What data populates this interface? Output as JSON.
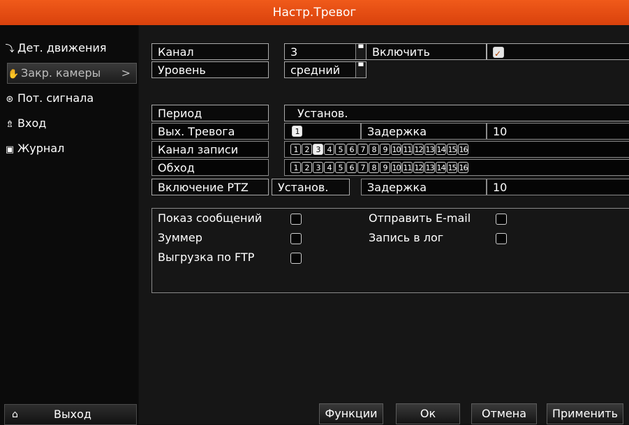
{
  "window": {
    "title": "Настр.Тревог"
  },
  "sidebar": {
    "items": [
      {
        "label": "Дет. движения",
        "icon": "motion-icon",
        "glyph": "⤵",
        "active": false
      },
      {
        "label": "Закр. камеры",
        "icon": "hand-icon",
        "glyph": "✋",
        "active": true,
        "chevron": ">"
      },
      {
        "label": "Пот. сигнала",
        "icon": "signal-icon",
        "glyph": "⊛",
        "active": false
      },
      {
        "label": "Вход",
        "icon": "input-icon",
        "glyph": "⇯",
        "active": false
      },
      {
        "label": "Журнал",
        "icon": "log-icon",
        "glyph": "▣",
        "active": false
      }
    ],
    "exit": {
      "label": "Выход",
      "icon": "home-icon",
      "glyph": "⌂"
    }
  },
  "form": {
    "channel": {
      "label": "Канал",
      "value": "3"
    },
    "enable": {
      "label": "Включить",
      "checked": true
    },
    "level": {
      "label": "Уровень",
      "value": "средний"
    },
    "period": {
      "label": "Период",
      "button": "Установ."
    },
    "alarm_out": {
      "label": "Вых. Тревога",
      "value": "1",
      "delay_label": "Задержка",
      "delay": "10"
    },
    "record_channel": {
      "label": "Канал записи",
      "numbers": [
        "1",
        "2",
        "3",
        "4",
        "5",
        "6",
        "7",
        "8",
        "9",
        "10",
        "11",
        "12",
        "13",
        "14",
        "15",
        "16"
      ],
      "selected": [
        "3"
      ]
    },
    "tour": {
      "label": "Обход",
      "numbers": [
        "1",
        "2",
        "3",
        "4",
        "5",
        "6",
        "7",
        "8",
        "9",
        "10",
        "11",
        "12",
        "13",
        "14",
        "15",
        "16"
      ],
      "selected": []
    },
    "ptz": {
      "label": "Включение PTZ",
      "button": "Установ.",
      "delay_label": "Задержка",
      "delay": "10"
    },
    "options": {
      "show_message": {
        "label": "Показ сообщений",
        "checked": false
      },
      "send_email": {
        "label": "Отправить E-mail",
        "checked": false
      },
      "buzzer": {
        "label": "Зуммер",
        "checked": false
      },
      "write_log": {
        "label": "Запись в лог",
        "checked": false
      },
      "ftp_upload": {
        "label": "Выгрузка по FTP",
        "checked": false
      }
    }
  },
  "footer": {
    "functions": "Функции",
    "ok": "Ок",
    "cancel": "Отмена",
    "apply": "Применить"
  },
  "colors": {
    "title_bar": "#e8501a",
    "background": "#161616",
    "sidebar": "#0b0b0b"
  }
}
